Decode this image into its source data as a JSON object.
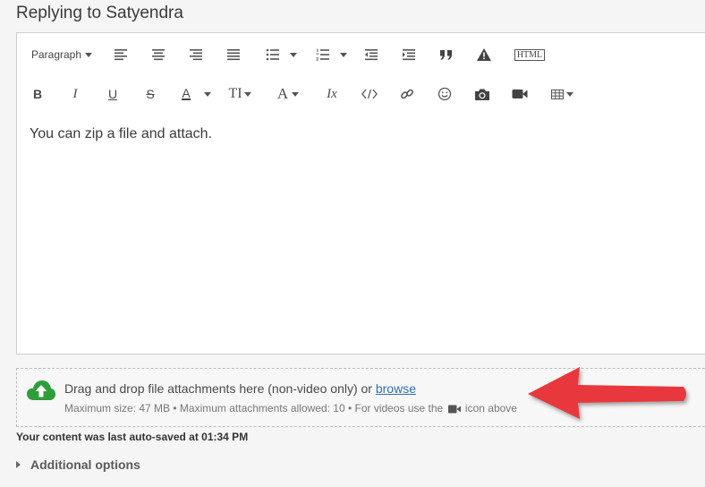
{
  "reply": {
    "title": "Replying to Satyendra"
  },
  "toolbar": {
    "paragraph_label": "Paragraph",
    "row1": [
      "paragraph-dropdown",
      "align-left-icon",
      "align-center-icon",
      "align-right-icon",
      "align-justify-icon",
      "bullet-list-icon",
      "numbered-list-icon",
      "outdent-icon",
      "indent-icon",
      "quote-icon",
      "warning-icon",
      "html-icon"
    ],
    "row2": [
      "bold-icon",
      "italic-icon",
      "underline-icon",
      "strikethrough-icon",
      "text-color-icon",
      "font-size-icon",
      "font-family-icon",
      "clear-format-icon",
      "code-icon",
      "link-icon",
      "emoji-icon",
      "camera-icon",
      "video-icon",
      "table-icon"
    ],
    "html_label": "HTML",
    "bold_label": "B",
    "italic_label": "I",
    "underline_label": "U",
    "strike_label": "S",
    "textcolor_label": "A",
    "fontsize_label": "TI",
    "fontfamily_label": "A",
    "clear_label": "Ix"
  },
  "editor": {
    "content": "You can zip a file and attach."
  },
  "dropzone": {
    "main_text": "Drag and drop file attachments here (non-video only) or ",
    "browse_link": "browse",
    "sub_text_before": "Maximum size: 47 MB • Maximum attachments allowed: 10 • For videos use the",
    "sub_text_after": "icon above"
  },
  "autosave": {
    "text": "Your content was last auto-saved at 01:34 PM"
  },
  "additional": {
    "label": "Additional options"
  },
  "colors": {
    "accent_link": "#2f6fb5",
    "cloud_green": "#2e9e3a",
    "arrow_red": "#e8393c"
  }
}
